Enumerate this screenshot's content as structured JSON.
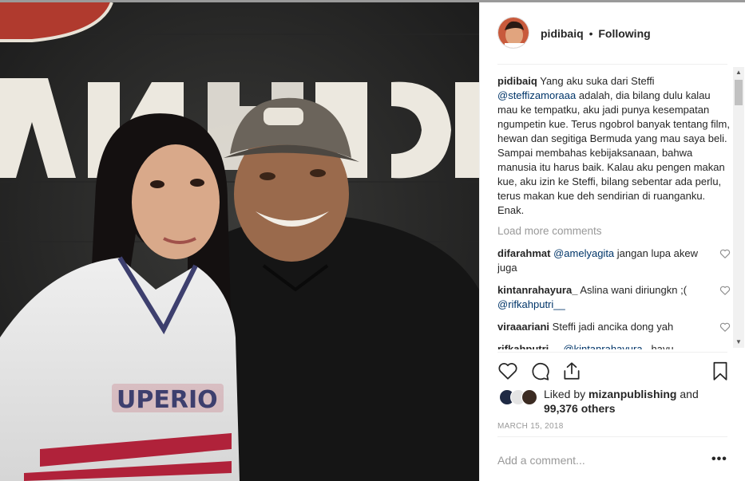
{
  "post": {
    "username": "pidibaiq",
    "separator": "•",
    "follow_status": "Following"
  },
  "caption": {
    "username": "pidibaiq",
    "text_before_mention": "Yang aku suka dari Steffi",
    "mention": "@steffizamoraaa",
    "text_after_mention": "adalah, dia bilang dulu kalau mau ke tempatku, aku jadi punya kesempatan ngumpetin kue. Terus ngobrol banyak tentang film, hewan dan segitiga Bermuda yang mau saya beli. Sampai membahas kebijaksanaan, bahwa manusia itu harus baik. Kalau aku pengen makan kue, aku izin ke Steffi, bilang sebentar ada perlu, terus makan kue deh sendirian di ruanganku. Enak."
  },
  "load_more_label": "Load more comments",
  "comments": [
    {
      "username": "difarahmat",
      "mention": "@amelyagita",
      "text": "jangan lupa akew juga"
    },
    {
      "username": "kintanrahayura_",
      "text": "Aslina wani diriungkn ;(",
      "mention": "@rifkahputri__"
    },
    {
      "username": "viraaariani",
      "text": "Steffi jadi ancika dong yah"
    },
    {
      "username": "rifkahputri__",
      "mention": "@kintanrahayura_",
      "text": "hayu"
    }
  ],
  "likes": {
    "prefix": "Liked by",
    "user": "mizanpublishing",
    "connector": "and",
    "count": "99,376 others"
  },
  "date": "MARCH 15, 2018",
  "add_comment_placeholder": "Add a comment...",
  "more_options": "•••",
  "icons": {
    "like": "heart-icon",
    "comment": "comment-icon",
    "share": "share-icon",
    "save": "bookmark-icon"
  },
  "colors": {
    "link": "#003569",
    "muted": "#999999",
    "text": "#262626",
    "divider": "#efefef"
  }
}
